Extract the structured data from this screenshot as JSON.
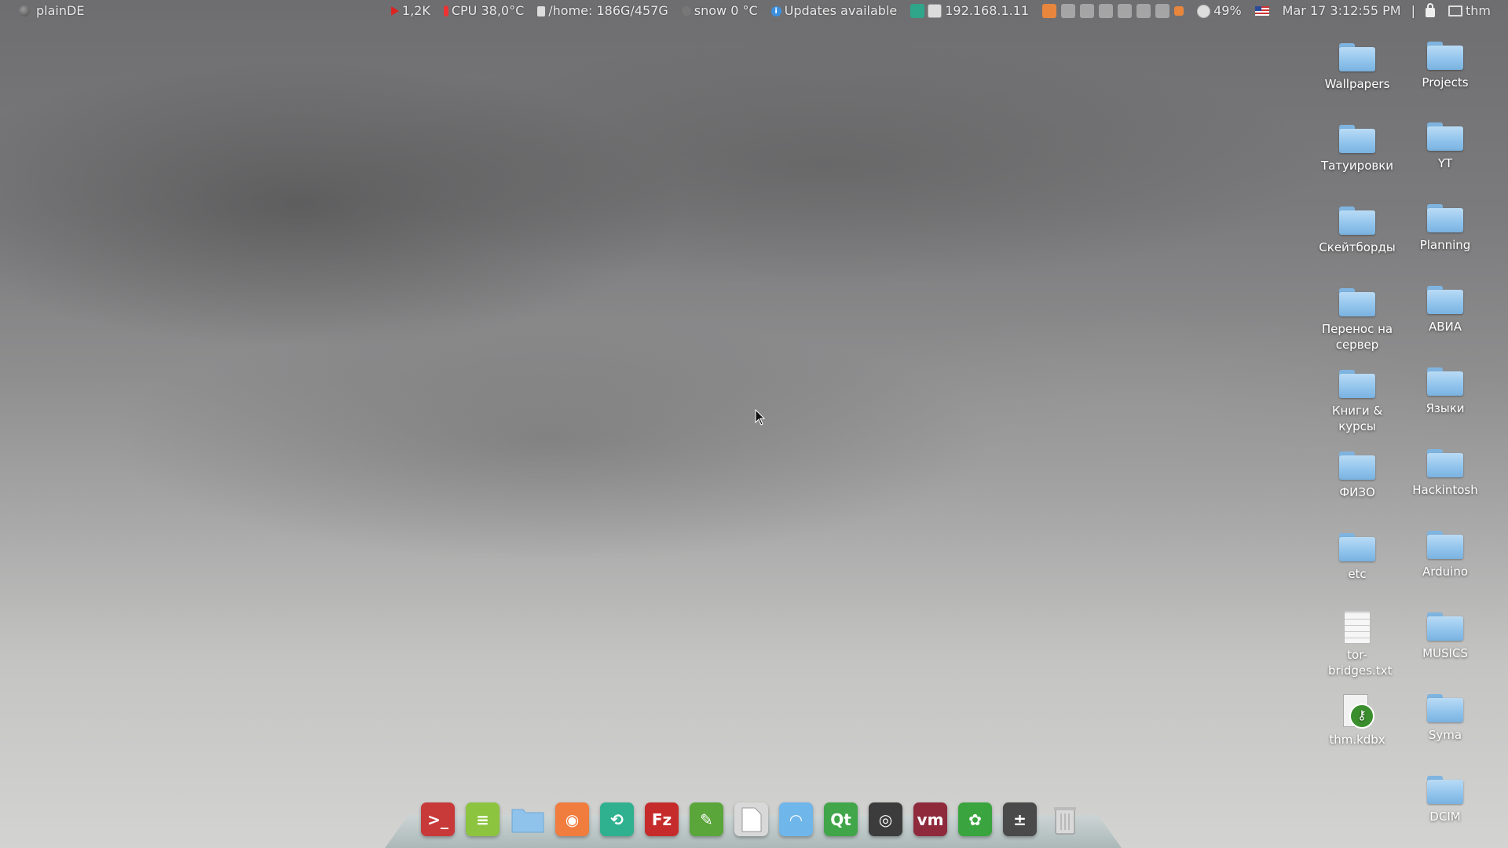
{
  "top_panel": {
    "de_name": "plainDE",
    "youtube_count": "1,2K",
    "cpu_temp": "CPU 38,0°C",
    "disk_usage": "/home: 186G/457G",
    "weather": "snow 0 °C",
    "updates": "Updates available",
    "ip": "192.168.1.11",
    "battery": "49%",
    "datetime": "Mar 17 3:12:55 PM",
    "separator": "|",
    "user": "thm"
  },
  "desktop_icons": {
    "col1": [
      {
        "label": "Wallpapers",
        "icon": "folder-icon"
      },
      {
        "label": "Татуировки",
        "icon": "folder-icon"
      },
      {
        "label": "Скейтборды",
        "icon": "folder-icon"
      },
      {
        "label": "Перенос на сервер",
        "icon": "folder-icon"
      },
      {
        "label": "Книги & курсы",
        "icon": "folder-icon"
      },
      {
        "label": "ФИЗО",
        "icon": "folder-icon"
      },
      {
        "label": "etc",
        "icon": "folder-icon"
      },
      {
        "label": "tor-bridges.txt",
        "icon": "text-file-icon"
      },
      {
        "label": "thm.kdbx",
        "icon": "keepass-file-icon"
      }
    ],
    "col2": [
      {
        "label": "Projects",
        "icon": "folder-icon"
      },
      {
        "label": "YT",
        "icon": "folder-icon"
      },
      {
        "label": "Planning",
        "icon": "folder-icon"
      },
      {
        "label": "АВИА",
        "icon": "folder-icon"
      },
      {
        "label": "Языки",
        "icon": "folder-icon"
      },
      {
        "label": "Hackintosh",
        "icon": "folder-icon"
      },
      {
        "label": "Arduino",
        "icon": "folder-icon"
      },
      {
        "label": "MUSICS",
        "icon": "folder-icon"
      },
      {
        "label": "Syma",
        "icon": "folder-icon"
      },
      {
        "label": "DCIM",
        "icon": "folder-icon"
      }
    ]
  },
  "dock": {
    "apps": [
      {
        "name": "terminal-icon",
        "glyph": ">_",
        "color": "#c8393a"
      },
      {
        "name": "text-editor-icon",
        "glyph": "≡",
        "color": "#8cc43f"
      },
      {
        "name": "file-manager-icon",
        "glyph": "",
        "color": "#8fc3ec"
      },
      {
        "name": "firefox-icon",
        "glyph": "◉",
        "color": "#f07c3e"
      },
      {
        "name": "sync-icon",
        "glyph": "⟲",
        "color": "#2fb18f"
      },
      {
        "name": "filezilla-icon",
        "glyph": "Fz",
        "color": "#c62b2b"
      },
      {
        "name": "tools-icon",
        "glyph": "✎",
        "color": "#5aa63a"
      },
      {
        "name": "document-icon",
        "glyph": "",
        "color": "#d8d8d8"
      },
      {
        "name": "browser-icon",
        "glyph": "◠",
        "color": "#6fb6ea"
      },
      {
        "name": "qt-creator-icon",
        "glyph": "Qt",
        "color": "#41a54a"
      },
      {
        "name": "obs-icon",
        "glyph": "◎",
        "color": "#3c3c3c"
      },
      {
        "name": "vmware-icon",
        "glyph": "vm",
        "color": "#8e2a3c"
      },
      {
        "name": "evernote-icon",
        "glyph": "✿",
        "color": "#3aa43e"
      },
      {
        "name": "calculator-icon",
        "glyph": "±",
        "color": "#4a4a4a"
      },
      {
        "name": "trash-icon",
        "glyph": "🗑",
        "color": "#bcbcbc"
      }
    ]
  }
}
